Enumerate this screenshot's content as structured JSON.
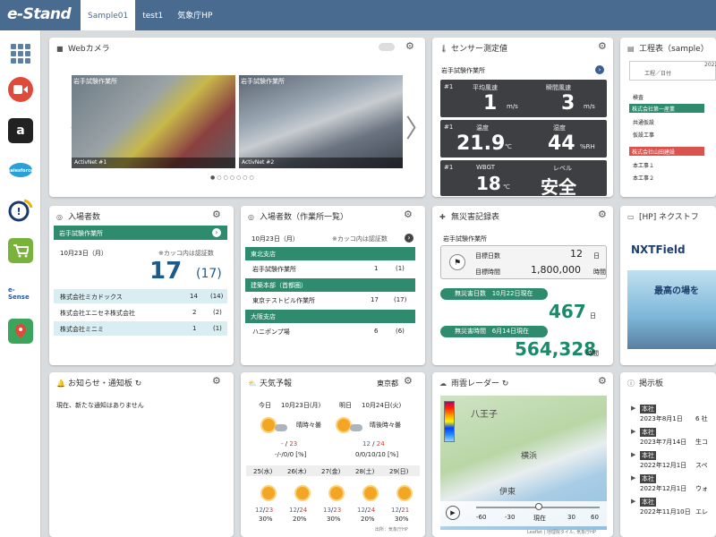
{
  "app": {
    "logo": "e-Stand",
    "tabs": [
      "Sample01",
      "test1",
      "気象庁HP"
    ]
  },
  "webcam": {
    "title": "Webカメラ",
    "cams": [
      {
        "label": "岩手試験作業所",
        "caption": "ActivNet #1"
      },
      {
        "label": "岩手試験作業所",
        "caption": "ActivNet #2"
      }
    ]
  },
  "sensor": {
    "title": "センサー測定値",
    "site": "岩手試験作業所",
    "blocks": [
      {
        "num": "#1",
        "l1": "平均風速",
        "v1": "1",
        "u1": "m/s",
        "l2": "瞬間風速",
        "v2": "3",
        "u2": "m/s"
      },
      {
        "num": "#1",
        "l1": "温度",
        "v1": "21.9",
        "u1": "℃",
        "l2": "湿度",
        "v2": "44",
        "u2": "%RH"
      },
      {
        "num": "#1",
        "l1": "WBGT",
        "v1": "18",
        "u1": "℃",
        "l2": "レベル",
        "v2": "安全",
        "u2": ""
      }
    ]
  },
  "schedule": {
    "title": "工程表（sample）",
    "header": "工程／日付",
    "year": "2022",
    "rows": [
      "検査",
      "株式会社第一産業",
      "共通仮設",
      "仮設工事",
      "株式会社山田建設",
      "本工事１",
      "本工事２"
    ]
  },
  "visitors": {
    "title": "入場者数",
    "site": "岩手試験作業所",
    "date": "10月23日（月）",
    "note": "※カッコ内は認証数",
    "total": "17",
    "auth": "(17)",
    "rows": [
      {
        "name": "株式会社ミカドックス",
        "n": "14",
        "a": "(14)"
      },
      {
        "name": "株式会社エニセネ株式会社",
        "n": "2",
        "a": "(2)"
      },
      {
        "name": "株式会社ミニミ",
        "n": "1",
        "a": "(1)"
      }
    ]
  },
  "visitors2": {
    "title": "入場者数（作業所一覧）",
    "date": "10月23日（月）",
    "note": "※カッコ内は認証数",
    "groups": [
      {
        "name": "東北支店",
        "rows": [
          {
            "name": "岩手試験作業所",
            "n": "1",
            "a": "(1)"
          }
        ]
      },
      {
        "name": "建築本部（首都圏）",
        "rows": [
          {
            "name": "東京テストビル作業所",
            "n": "17",
            "a": "(17)"
          }
        ]
      },
      {
        "name": "大阪支店",
        "rows": [
          {
            "name": "ハニポンプ場",
            "n": "6",
            "a": "(6)"
          }
        ]
      }
    ]
  },
  "safety": {
    "title": "無災害記録表",
    "site": "岩手試験作業所",
    "goal_days_label": "目標日数",
    "goal_days": "12",
    "goal_days_unit": "日",
    "goal_hours_label": "目標時間",
    "goal_hours": "1,800,000",
    "goal_hours_unit": "時間",
    "pill1": "無災害日数",
    "pill1_date": "10月22日現在",
    "days": "467",
    "days_unit": "日",
    "pill2": "無災害時間",
    "pill2_date": "6月14日現在",
    "hours": "564,328",
    "hours_unit": "時間"
  },
  "next": {
    "title": "[HP] ネクストフ",
    "logo": "NXTField",
    "banner": "最高の場を"
  },
  "notice": {
    "title": "お知らせ・通知板",
    "body": "現在、新たな通知はありません"
  },
  "weather": {
    "title": "天気予報",
    "area": "東京都",
    "today": {
      "label": "今日",
      "date": "10月23日(月)",
      "desc": "晴時々曇",
      "temp_low": "-",
      "temp_high": "23",
      "rain": "-/-/0/0 [%]"
    },
    "tomorrow": {
      "label": "明日",
      "date": "10月24日(火)",
      "desc": "晴後時々曇",
      "temp_low": "12",
      "temp_high": "24",
      "rain": "0/0/10/10 [%]"
    },
    "week": [
      {
        "d": "25(水)",
        "lo": "12",
        "hi": "23",
        "p": "30%"
      },
      {
        "d": "26(木)",
        "lo": "12",
        "hi": "24",
        "p": "20%"
      },
      {
        "d": "27(金)",
        "lo": "13",
        "hi": "23",
        "p": "30%"
      },
      {
        "d": "28(土)",
        "lo": "12",
        "hi": "24",
        "p": "20%"
      },
      {
        "d": "29(日)",
        "lo": "12",
        "hi": "21",
        "p": "30%"
      }
    ],
    "source": "出所：気象庁HP"
  },
  "radar": {
    "title": "雨雲レーダー",
    "ticks": [
      "-60",
      "-30",
      "現在",
      "30",
      "60"
    ],
    "credit": "Leaflet | 地理院タイル, 気象庁HP",
    "places": [
      "八王子",
      "横浜",
      "伊東"
    ]
  },
  "board": {
    "title": "掲示板",
    "items": [
      {
        "tag": "本社",
        "date": "2023年8月1日",
        "t": "6 社"
      },
      {
        "tag": "本社",
        "date": "2023年7月14日",
        "t": "生コ"
      },
      {
        "tag": "本社",
        "date": "2022年12月1日",
        "t": "スペ"
      },
      {
        "tag": "本社",
        "date": "2022年12月1日",
        "t": "ウォ"
      },
      {
        "tag": "本社",
        "date": "2022年11月10日",
        "t": "エレ"
      }
    ]
  }
}
